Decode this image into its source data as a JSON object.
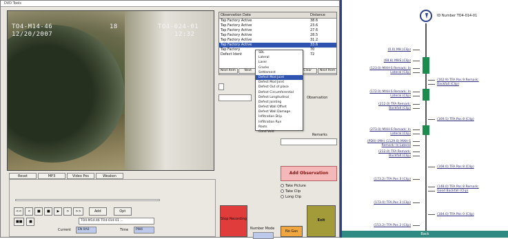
{
  "window": {
    "title": "DVD  Tools"
  },
  "video": {
    "osd_top_left": "TO4-M14-46",
    "osd_top_date": "12/20/2007",
    "osd_top_mid": "18",
    "osd_top_right_1": "TO4-024-01",
    "osd_top_right_2": "12:32"
  },
  "tabs": [
    "Reset",
    "MP3",
    "Video Pos",
    "Weaken"
  ],
  "controls": {
    "buttons": [
      "<<",
      "<",
      "■",
      "■",
      "▶",
      ">",
      ">>",
      "Add",
      "Opt"
    ],
    "buttons2": [
      "■■",
      "■"
    ],
    "combo_value": "TO4-M14-46 TO4-014-01 ...",
    "label_a": "Current",
    "value_a": "EN 0A0",
    "label_b": "Time",
    "value_b": "PW4"
  },
  "observations": {
    "col1": "Observation Date",
    "col2": "Distance",
    "rows": [
      [
        "Tap Factory Active",
        "38.6"
      ],
      [
        "Tap Factory Active",
        "23.6"
      ],
      [
        "Tap Factory Active",
        "27.6"
      ],
      [
        "Tap Factory Active",
        "28.5"
      ],
      [
        "Tap Factory Active",
        "31.2"
      ],
      [
        "Tap Factory Active",
        "33.6"
      ],
      [
        "Tap Factory",
        "70"
      ],
      [
        "Defect Ident",
        "72"
      ]
    ],
    "selected_row": 5
  },
  "dropdown_items": [
    "SBL",
    "Lateral",
    "Laser",
    "Cracks",
    "Settlement",
    "Defect Mod Joint",
    "Defect Mod Joint",
    "Defect Out of place",
    "Defect Circumferential",
    "Defect Longitudinal",
    "Defect Jointing",
    "Defect Wall Offset",
    "Defect Wall Damage",
    "Infiltration Drip",
    "Infiltration Run",
    "Roots",
    "Cond Void"
  ],
  "dropdown_selected": 5,
  "small_buttons": [
    "Next Item",
    "Next",
    "Back",
    "Next",
    "Clear",
    "Next Item"
  ],
  "labels": {
    "observation": "Observation",
    "remarks": "Remarks"
  },
  "add_observation": "Add Observation",
  "radios": [
    "Take Picture",
    "Take Clip",
    "Long Clip"
  ],
  "big_buttons": {
    "red": "Stop Recording",
    "number_label": "Number Mode",
    "orange": "No Gas",
    "olive": "Exit"
  },
  "log": {
    "heading": "ID Number TO4-014-01",
    "left": [
      {
        "text": "(0.0) MH (Clip)"
      },
      {
        "text": "(68.8) MHS (Clip)"
      },
      {
        "text": "(123.0) MXH-S Remark: In"
      },
      {
        "text": "Lateral (Clip)"
      },
      {
        "text": "(172.0) MXH-S Remark: In"
      },
      {
        "text": "Lateral (Clip)"
      },
      {
        "text": "(212.0) TFA Remark:"
      },
      {
        "text": "Backfall (Clip)"
      },
      {
        "text": "(273.0) MXH-S Remark: In"
      },
      {
        "text": "Lateral (Clip)"
      },
      {
        "text": "(PD0) (MH) (1129.0) MXH-S"
      },
      {
        "text": "Remark: In Lateral"
      },
      {
        "text": "(212.0) TFA Remark:"
      },
      {
        "text": "Backfall (Clip)"
      },
      {
        "text": "(173.2) TFA Pos 3 (Clip)"
      },
      {
        "text": "(173.0) TFA Pos 3 (Clip)"
      },
      {
        "text": "(153.2) TFA Pos 2 (Clip)"
      }
    ],
    "right": [
      {
        "text": "(162.9) TFA Pos 9 Remark:"
      },
      {
        "text": "Backfall (Clip)"
      },
      {
        "text": "(169.5) TFA Pos 8 (Clip)"
      },
      {
        "text": "(168.0) TFA Pos 8 (Clip)"
      },
      {
        "text": "(148.0) TFA Pos 8 Remark:"
      },
      {
        "text": "Good Backfall (Clip)"
      },
      {
        "text": "(184.0) TFA Pos 0 (Clip)"
      }
    ],
    "footer": "Back"
  }
}
